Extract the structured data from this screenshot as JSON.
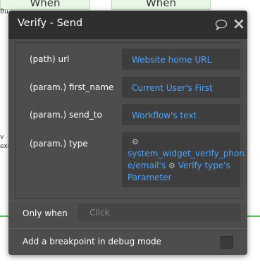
{
  "background": {
    "left_card_label": "When",
    "right_card_label": "When",
    "strip_fragments": [
      "Bu",
      "v",
      "exi"
    ],
    "accent_green": "#57c35a"
  },
  "popup": {
    "title": "Verify - Send",
    "icons": {
      "comment": "comment-icon",
      "close": "close-icon"
    },
    "params": [
      {
        "label": "(path) url",
        "value": "Website home URL"
      },
      {
        "label": "(param.) first_name",
        "value": "Current User's First"
      },
      {
        "label": "(param.) send_to",
        "value": "Workflow's text"
      },
      {
        "label": "(param.) type",
        "value_part1": "system_widget_verify_phone/email's",
        "value_line1": "system_widget_verify_phon",
        "value_line2": "e/email's",
        "value_part2": "Verify type's",
        "value_line3": "Parameter",
        "gear_icon": "gear-icon"
      }
    ],
    "only_when": {
      "label": "Only when",
      "placeholder": "Click"
    },
    "breakpoint": {
      "label": "Add a breakpoint in debug mode",
      "checked": false
    },
    "colors": {
      "link": "#4da3ff",
      "panel": "#4d4d4d",
      "header": "#2f2f2f"
    }
  }
}
